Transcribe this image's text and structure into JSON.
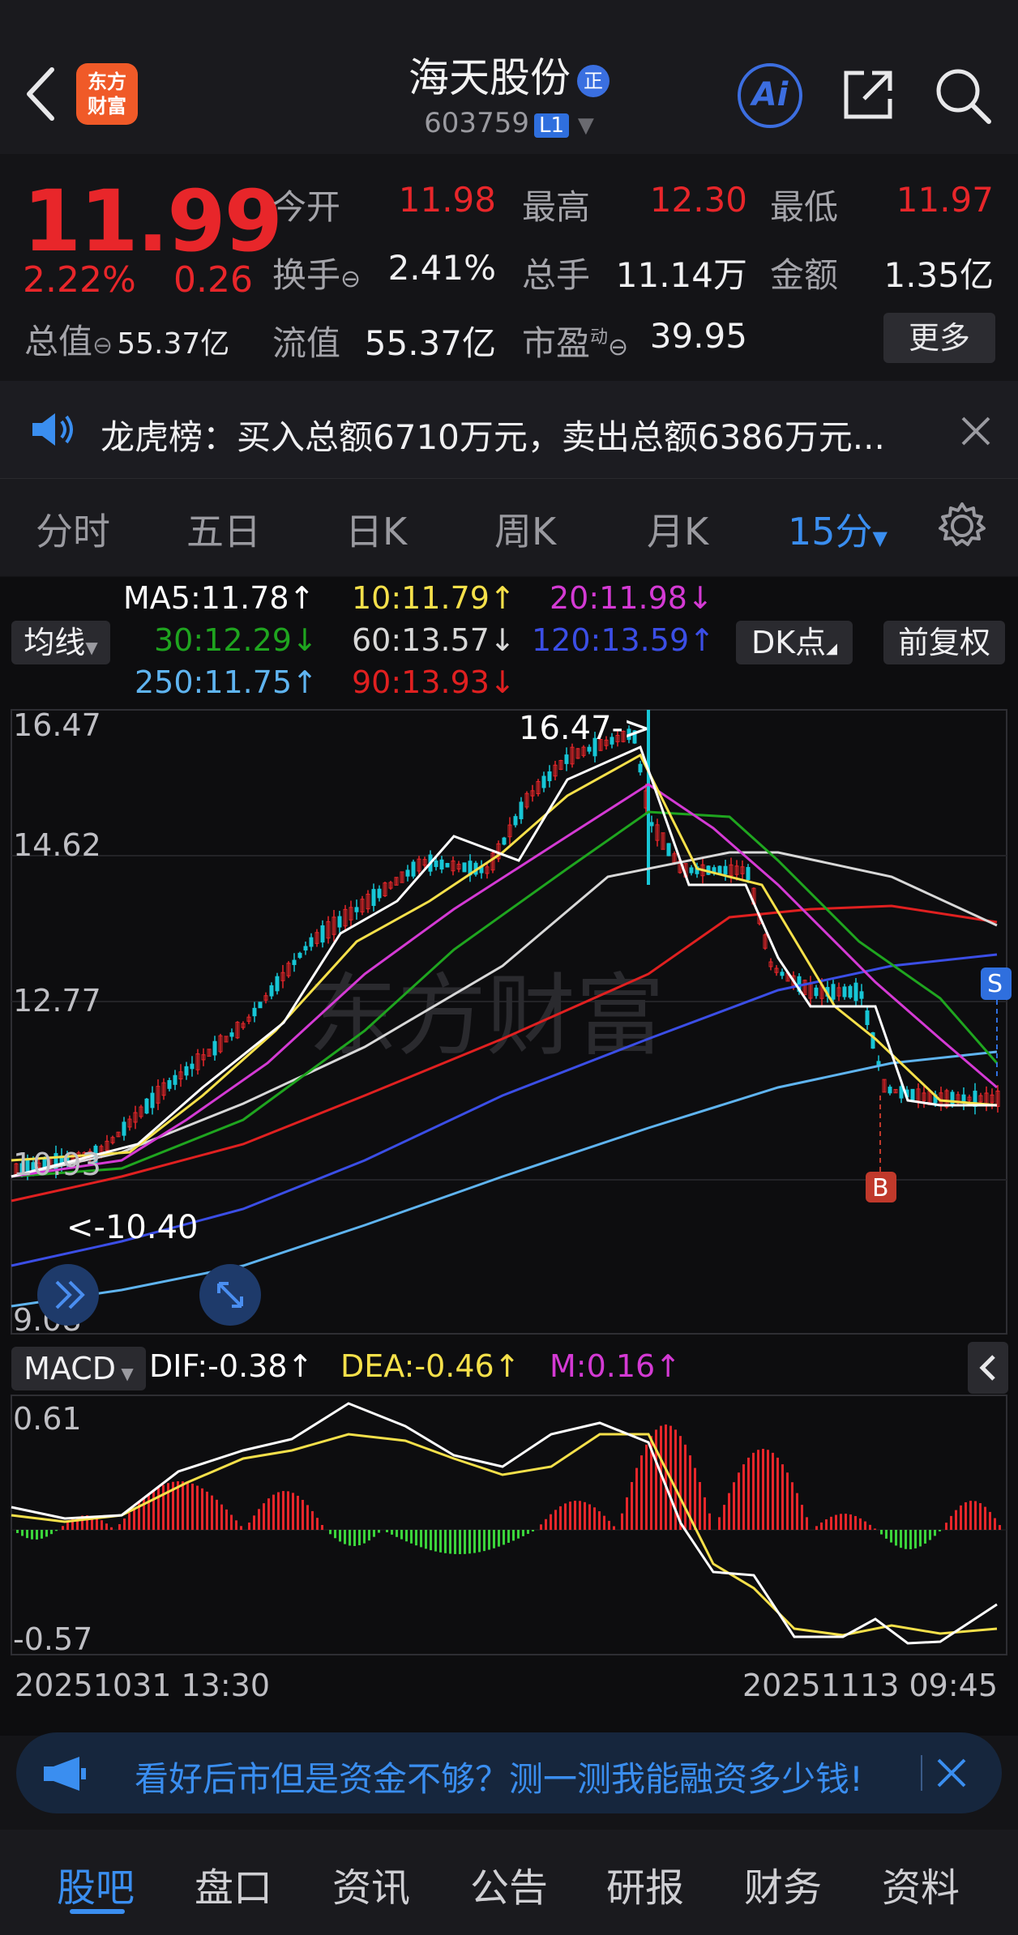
{
  "header": {
    "logo_text_1": "东方",
    "logo_text_2": "财富",
    "stock_name": "海天股份",
    "zheng_badge": "正",
    "stock_code": "603759",
    "level_badge": "L1",
    "ai_label": "Ai"
  },
  "quote": {
    "price": "11.99",
    "change_pct": "2.22%",
    "change_amt": "0.26",
    "open_label": "今开",
    "open_value": "11.98",
    "high_label": "最高",
    "high_value": "12.30",
    "low_label": "最低",
    "low_value": "11.97",
    "turnover_label": "换手",
    "turnover_value": "2.41%",
    "volume_label": "总手",
    "volume_value": "11.14万",
    "amount_label": "金额",
    "amount_value": "1.35亿",
    "total_cap_label": "总值",
    "total_cap_value": "55.37亿",
    "float_cap_label": "流值",
    "float_cap_value": "55.37亿",
    "pe_label": "市盈",
    "pe_super": "动",
    "pe_value": "39.95",
    "more_button": "更多"
  },
  "dragon": {
    "text": "龙虎榜：买入总额6710万元，卖出总额6386万元..."
  },
  "tabs": {
    "items": [
      "分时",
      "五日",
      "日K",
      "周K",
      "月K",
      "15分"
    ],
    "active": "15分"
  },
  "ma_panel": {
    "dropdown": "均线",
    "ma5": "MA5:11.78↑",
    "ma10": "10:11.79↑",
    "ma20": "20:11.98↓",
    "ma30": "30:12.29↓",
    "ma60": "60:13.57↓",
    "ma120": "120:13.59↑",
    "ma250": "250:11.75↑",
    "ma90": "90:13.93↓",
    "dk_button": "DK点",
    "fq_button": "前复权",
    "colors": {
      "ma5": "#ffffff",
      "ma10": "#f5e04a",
      "ma20": "#d43ad4",
      "ma30": "#1fa51f",
      "ma60": "#d8d8d8",
      "ma120": "#3b4ee6",
      "ma250": "#5fb4f0",
      "ma90": "#e02020"
    }
  },
  "price_chart": {
    "y_labels": [
      "16.47",
      "14.62",
      "12.77",
      "10.93",
      "9.08"
    ],
    "max_annotation": "16.47->",
    "min_annotation": "<-10.40",
    "buy_marker": "B",
    "sell_marker": "S",
    "watermark": "东方财富"
  },
  "macd": {
    "dropdown": "MACD",
    "dif": "DIF:-0.38↑",
    "dea": "DEA:-0.46↑",
    "m": "M:0.16↑",
    "y_top": "0.61",
    "y_bottom": "-0.57"
  },
  "time_axis": {
    "start": "20251031 13:30",
    "end": "20251113 09:45"
  },
  "banner": {
    "text": "看好后市但是资金不够？测一测我能融资多少钱!"
  },
  "bottom_tabs": {
    "items": [
      "股吧",
      "盘口",
      "资讯",
      "公告",
      "研报",
      "财务",
      "资料"
    ],
    "active": "股吧"
  }
}
